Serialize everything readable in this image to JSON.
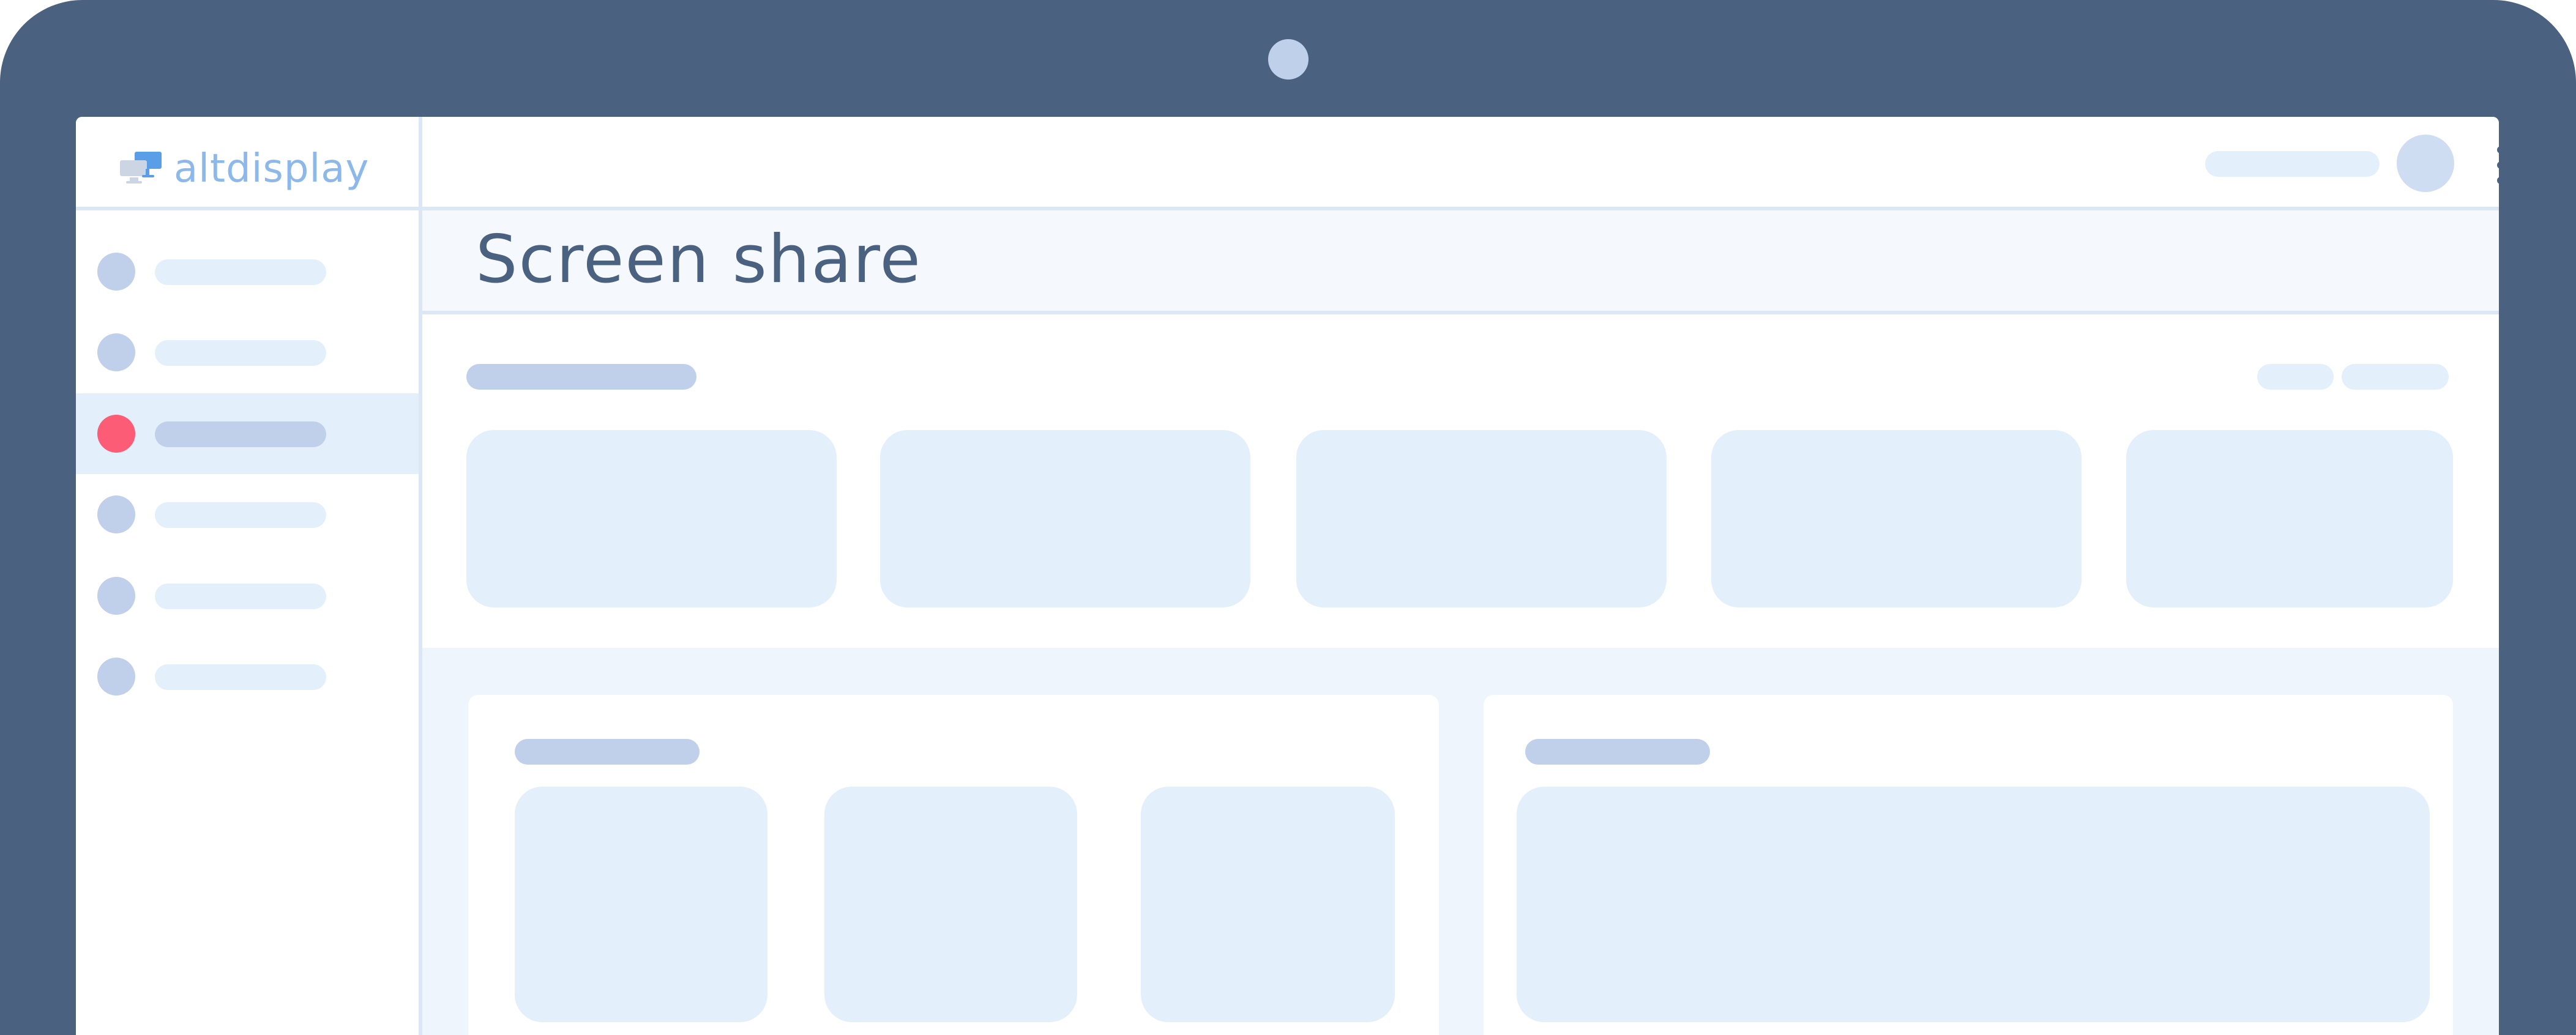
{
  "app": {
    "logo_text": "altdisplay",
    "page_title": "Screen share"
  },
  "sidebar": {
    "items": [
      {
        "active": false
      },
      {
        "active": false
      },
      {
        "active": true
      },
      {
        "active": false
      },
      {
        "active": false
      },
      {
        "active": false
      }
    ]
  },
  "colors": {
    "bezel": "#4b6180",
    "accent_active": "#fc5c76",
    "placeholder_light": "#e4effc",
    "placeholder_dark": "#c0d0ea",
    "logo": "#8db8ea"
  },
  "icons": {
    "logo": "altdisplay-logo-icon",
    "menu": "kebab-menu-icon"
  }
}
